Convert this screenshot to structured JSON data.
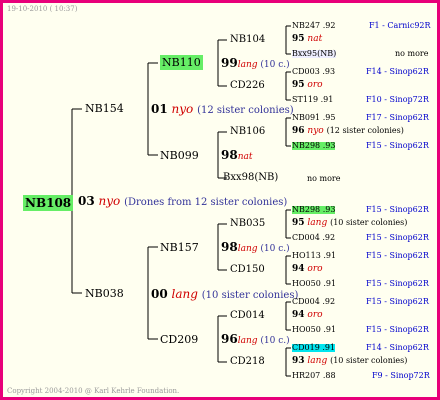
{
  "header": {
    "date": "19-10-2010 ( 10:37)"
  },
  "footer": {
    "copyright": "Copyright 2004-2010 @ Karl Kehrle Foundation."
  },
  "colors": {
    "border": "#e8007a",
    "green_highlight": "#66ee66",
    "cyan_highlight": "#00e5ee",
    "queen_name": "#d00000",
    "location": "#0000cc"
  },
  "root": {
    "name": "NB108",
    "year": "03",
    "queen": "nyo",
    "note": "(Drones from 12 sister colonies)"
  },
  "gen1": {
    "top": {
      "name": "NB154",
      "year": "01",
      "queen": "nyo",
      "note": "(12 sister colonies)"
    },
    "bottom": {
      "name": "NB038",
      "year": "00",
      "queen": "lang",
      "note": "(10 sister colonies)"
    }
  },
  "gen2": {
    "a": {
      "name": "NB110",
      "year": "99",
      "queen": "lang",
      "note": "(10 c.)"
    },
    "b": {
      "name": "NB099",
      "year": "98",
      "queen": "nat"
    },
    "c": {
      "name": "NB157",
      "year": "98",
      "queen": "lang",
      "note": "(10 c.)"
    },
    "d": {
      "name": "CD209",
      "year": "96",
      "queen": "lang",
      "note": "(10 c.)"
    }
  },
  "gen3": {
    "a1": {
      "name": "NB104",
      "year": "95",
      "queen": "nat"
    },
    "a2": {
      "name": "CD226",
      "year": "95",
      "queen": "oro"
    },
    "b1": {
      "name": "NB106",
      "year": "96",
      "queen": "nyo",
      "note": "(12 sister colonies)"
    },
    "b2": {
      "name": "Bxx98(NB)",
      "nomore": "no more"
    },
    "c1": {
      "name": "NB035",
      "year": "95",
      "queen": "lang",
      "note": "(10 sister colonies)"
    },
    "c2": {
      "name": "CD150",
      "year": "94",
      "queen": "oro"
    },
    "d1": {
      "name": "CD014",
      "year": "94",
      "queen": "oro"
    },
    "d2": {
      "name": "CD218",
      "year": "93",
      "queen": "lang",
      "note": "(10 sister colonies)"
    }
  },
  "leaves": [
    {
      "id": "NB247 .92",
      "loc": "F1 - Carnic92R"
    },
    {
      "id": "Bxx95(NB)",
      "loc": "no more"
    },
    {
      "id": "CD003 .93",
      "loc": "F14 - Sinop62R"
    },
    {
      "id": "ST119 .91",
      "loc": "F10 - Sinop72R"
    },
    {
      "id": "NB091 .95",
      "loc": "F17 - Sinop62R"
    },
    {
      "id": "NB298 .93",
      "loc": "F15 - Sinop62R"
    },
    {
      "id": "NB298 .93",
      "loc": "F15 - Sinop62R"
    },
    {
      "id": "CD004 .92",
      "loc": "F15 - Sinop62R"
    },
    {
      "id": "HO113 .91",
      "loc": "F15 - Sinop62R"
    },
    {
      "id": "HO050 .91",
      "loc": "F15 - Sinop62R"
    },
    {
      "id": "CD004 .92",
      "loc": "F15 - Sinop62R"
    },
    {
      "id": "HO050 .91",
      "loc": "F15 - Sinop62R"
    },
    {
      "id": "CD019 .91",
      "loc": "F14 - Sinop62R"
    },
    {
      "id": "HR207 .88",
      "loc": "F9 - Sinop72R"
    }
  ]
}
